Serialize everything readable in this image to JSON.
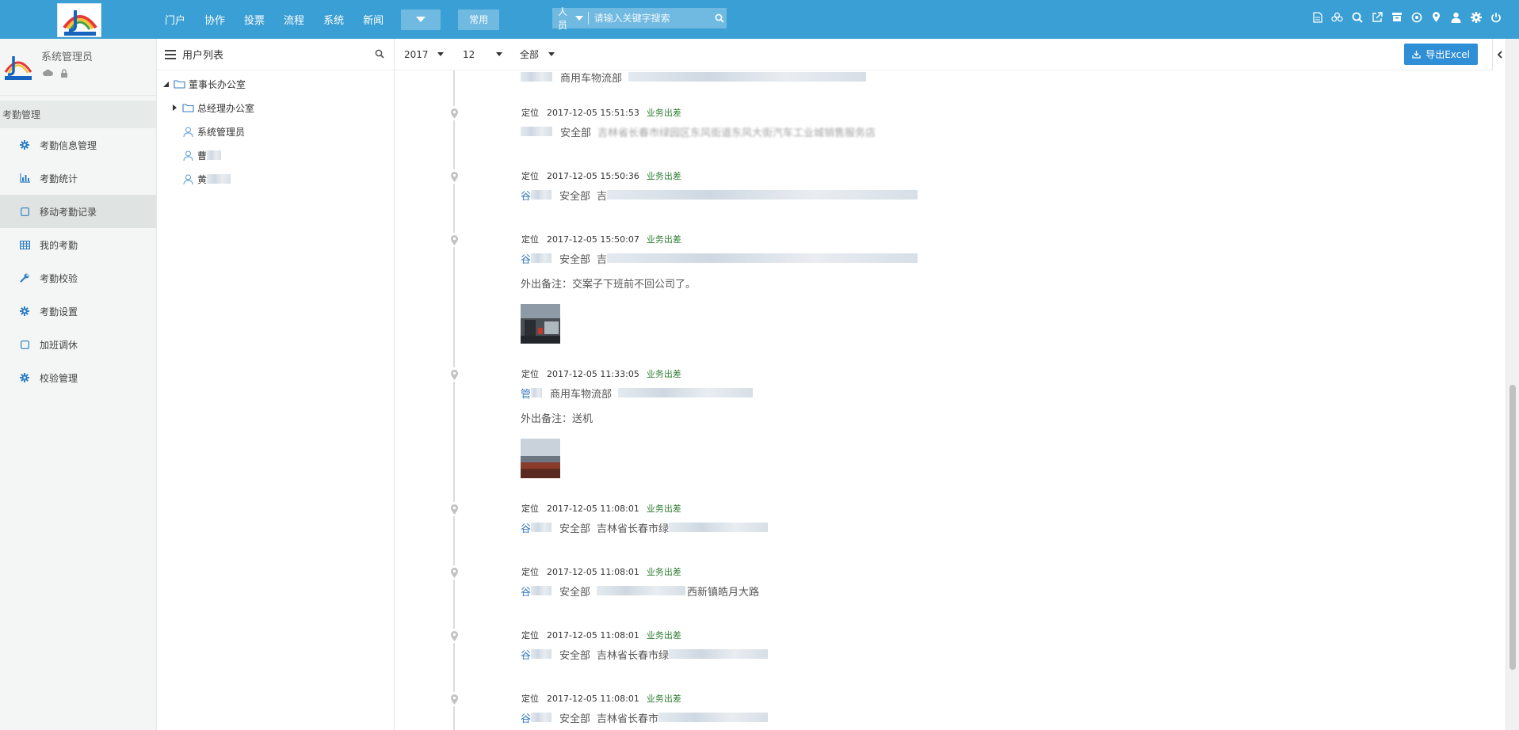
{
  "topbar": {
    "nav": [
      "门户",
      "协作",
      "投票",
      "流程",
      "系统",
      "新闻"
    ],
    "common_label": "常用",
    "search": {
      "category": "人员",
      "placeholder": "请输入关键字搜索"
    },
    "icons": [
      "document-icon",
      "users-icon",
      "search-icon",
      "external-link-icon",
      "archive-icon",
      "target-icon",
      "location-icon",
      "user-icon",
      "settings-icon",
      "power-icon"
    ]
  },
  "sidebar": {
    "user_name": "系统管理员",
    "group_title": "考勤管理",
    "items": [
      {
        "label": "考勤信息管理",
        "icon": "gear-icon"
      },
      {
        "label": "考勤统计",
        "icon": "bar-chart-icon"
      },
      {
        "label": "移动考勤记录",
        "icon": "square-icon",
        "active": true
      },
      {
        "label": "我的考勤",
        "icon": "grid-icon"
      },
      {
        "label": "考勤校验",
        "icon": "wrench-icon"
      },
      {
        "label": "考勤设置",
        "icon": "gear-icon"
      },
      {
        "label": "加班调休",
        "icon": "square-icon"
      },
      {
        "label": "校验管理",
        "icon": "gear-icon"
      }
    ]
  },
  "tree": {
    "title": "用户列表",
    "nodes": [
      {
        "label": "董事长办公室",
        "type": "folder",
        "expanded": true,
        "level": 0
      },
      {
        "label": "总经理办公室",
        "type": "folder",
        "expanded": false,
        "level": 1
      },
      {
        "label": "系统管理员",
        "type": "user",
        "level": 1
      },
      {
        "label": "曹",
        "type": "user",
        "level": 1
      },
      {
        "label": "黄",
        "type": "user",
        "level": 1
      }
    ]
  },
  "filters": {
    "year": "2017",
    "month": "12",
    "scope": "全部",
    "export_label": "导出Excel"
  },
  "timeline": {
    "top_partial": {
      "dept": "商用车物流部"
    },
    "entries": [
      {
        "type": "定位",
        "time": "2017-12-05 15:51:53",
        "tag": "业务出差",
        "person": "",
        "dept": "安全部",
        "location": "吉林省长春市绿园区东风街道东风大街汽车工业城销售服务店",
        "note": "",
        "photo": false
      },
      {
        "type": "定位",
        "time": "2017-12-05 15:50:36",
        "tag": "业务出差",
        "person": "谷",
        "dept": "安全部",
        "location": "吉",
        "note": "",
        "photo": false
      },
      {
        "type": "定位",
        "time": "2017-12-05 15:50:07",
        "tag": "业务出差",
        "person": "谷",
        "dept": "安全部",
        "location": "吉",
        "note": "外出备注：交案子下班前不回公司了。",
        "photo": true
      },
      {
        "type": "定位",
        "time": "2017-12-05 11:33:05",
        "tag": "业务出差",
        "person": "管",
        "dept": "商用车物流部",
        "location": "",
        "note": "外出备注：送机",
        "photo": true
      },
      {
        "type": "定位",
        "time": "2017-12-05 11:08:01",
        "tag": "业务出差",
        "person": "谷",
        "dept": "安全部",
        "location": "吉林省长春市绿",
        "note": "",
        "photo": false
      },
      {
        "type": "定位",
        "time": "2017-12-05 11:08:01",
        "tag": "业务出差",
        "person": "谷",
        "dept": "安全部",
        "location": "西新镇皓月大路",
        "note": "",
        "photo": false
      },
      {
        "type": "定位",
        "time": "2017-12-05 11:08:01",
        "tag": "业务出差",
        "person": "谷",
        "dept": "安全部",
        "location": "吉林省长春市绿",
        "note": "",
        "photo": false
      },
      {
        "type": "定位",
        "time": "2017-12-05 11:08:01",
        "tag": "业务出差",
        "person": "谷",
        "dept": "安全部",
        "location": "吉林省长春市",
        "note": "",
        "photo": false
      }
    ]
  }
}
